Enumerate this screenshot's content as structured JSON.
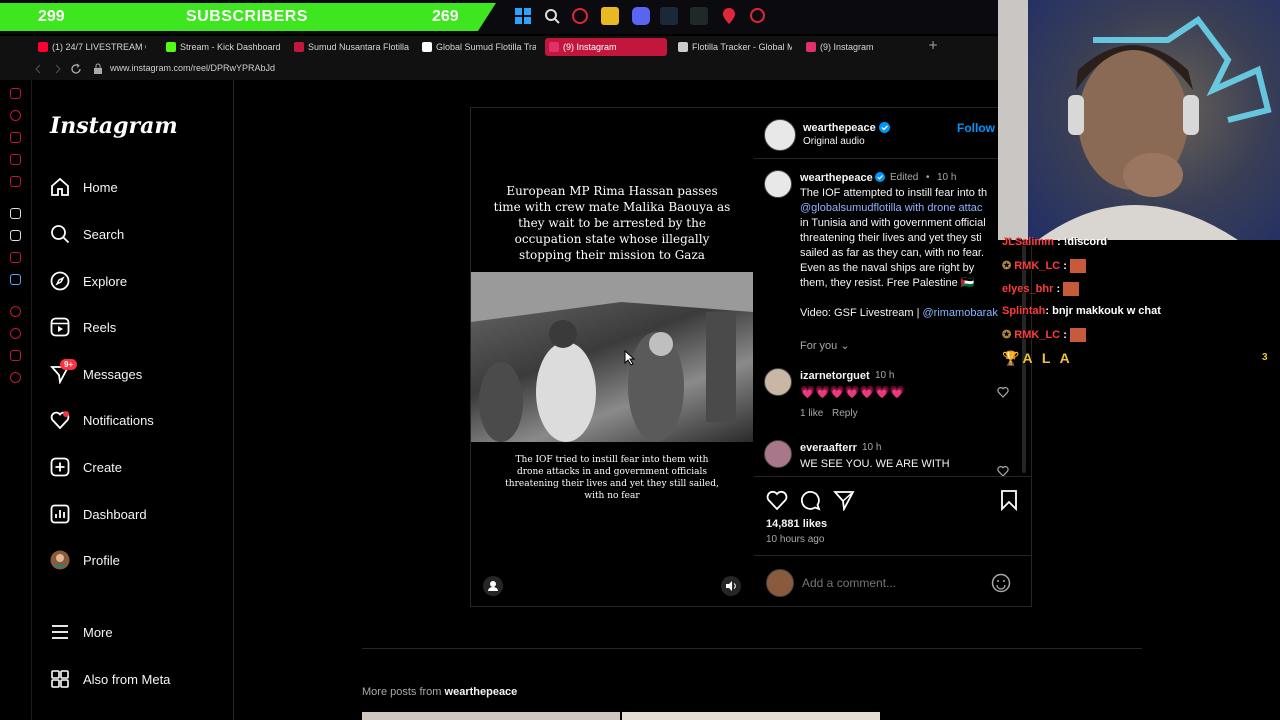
{
  "banner": {
    "left_count": "299",
    "title": "SUBSCRIBERS",
    "right_count": "269"
  },
  "tabs": [
    {
      "label": "(1) 24/7 LIVESTREAM OF",
      "color": "#ff0033"
    },
    {
      "label": "Stream - Kick Dashboard",
      "color": "#53fc18"
    },
    {
      "label": "Sumud Nusantara Flotilla",
      "color": "#c2163d"
    },
    {
      "label": "Global Sumud Flotilla Tra",
      "color": "#ffffff"
    },
    {
      "label": "(9) Instagram",
      "color": "#e1306c"
    },
    {
      "label": "Flotilla Tracker - Global M",
      "color": "#cccccc"
    },
    {
      "label": "(9) Instagram",
      "color": "#e1306c"
    }
  ],
  "new_tab": "+",
  "url": "www.instagram.com/reel/DPRwYPRAbJd",
  "ig": {
    "logo": "Instagram",
    "nav": [
      {
        "label": "Home",
        "icon": "home-icon"
      },
      {
        "label": "Search",
        "icon": "search-icon"
      },
      {
        "label": "Explore",
        "icon": "explore-icon"
      },
      {
        "label": "Reels",
        "icon": "reels-icon"
      },
      {
        "label": "Messages",
        "icon": "messages-icon",
        "badge": "9+"
      },
      {
        "label": "Notifications",
        "icon": "heart-icon"
      },
      {
        "label": "Create",
        "icon": "create-icon"
      },
      {
        "label": "Dashboard",
        "icon": "dashboard-icon"
      },
      {
        "label": "Profile",
        "icon": "profile-avatar"
      },
      {
        "label": "More",
        "icon": "menu-icon"
      },
      {
        "label": "Also from Meta",
        "icon": "meta-icon"
      }
    ]
  },
  "post": {
    "headline": "European MP Rima Hassan passes time with crew mate Malika Baouya as they wait to be arrested by the occupation state whose illegally stopping their mission to Gaza",
    "video_caption": "The IOF tried to instill fear into them with drone attacks in and government officials threatening their lives and yet they still sailed, with no fear",
    "author": "wearthepeace",
    "audio": "Original audio",
    "follow": "Follow",
    "edited": "Edited",
    "time": "10 h",
    "caption_lines": [
      "The IOF attempted to instill fear into th",
      "@globalsumudflotilla with drone attac",
      "in Tunisia and with government official",
      "threatening their lives and yet they sti",
      "sailed as far as they can, with no fear.",
      "Even as the naval ships are right by",
      "them, they resist. Free Palestine 🇵🇸"
    ],
    "video_credit": "Video: GSF Livestream |",
    "video_credit_link": "@rimamobarak",
    "for_you": "For you",
    "comments": [
      {
        "user": "izarnetorguet",
        "time": "10 h",
        "text": "💗💗💗💗💗💗💗",
        "likes": "1 like",
        "reply": "Reply"
      },
      {
        "user": "everaafterr",
        "time": "10 h",
        "text": "WE SEE YOU. WE ARE WITH"
      }
    ],
    "likes": "14,881 likes",
    "posted": "10 hours ago",
    "comment_placeholder": "Add a comment..."
  },
  "chat": [
    {
      "user": "JLSalimm",
      "msg": ": !discord"
    },
    {
      "user": "RMK_LC",
      "msg": ":"
    },
    {
      "user": "elyes_bhr",
      "msg": ":"
    },
    {
      "user": "Splintah",
      "msg": ": bnjr makkouk w chat"
    },
    {
      "user": "RMK_LC",
      "msg": ":"
    },
    {
      "user": "",
      "msg": "A L A"
    }
  ],
  "chat_count": "3",
  "more": {
    "prefix": "More posts from",
    "user": "wearthepeace"
  }
}
